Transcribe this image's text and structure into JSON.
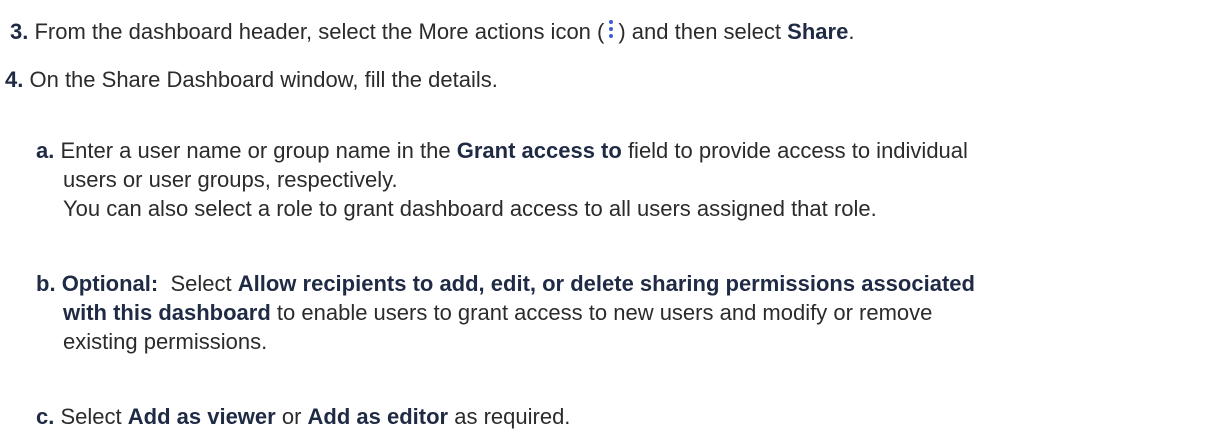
{
  "steps": [
    {
      "number": "3.",
      "text_before": "From the dashboard header, select the More actions icon (",
      "icon": "more-actions-kebab-icon",
      "text_after": ") and then select",
      "bold": "Share",
      "end": "."
    },
    {
      "number": "4.",
      "text": "On the Share Dashboard window, fill the details."
    }
  ],
  "substeps": {
    "a": {
      "label": "a.",
      "line1_before": "Enter a user name or group name in the",
      "line1_bold": "Grant access to",
      "line1_after": "field to provide access to individual",
      "line2": "users or user groups, respectively.",
      "line3": "You can also select a role to grant dashboard access to all users assigned that role."
    },
    "b": {
      "label": "b.",
      "optional": "Optional:",
      "select": "Select",
      "bold1": "Allow recipients to add, edit, or delete sharing permissions associated",
      "bold2": "with this dashboard",
      "line2_after": "to enable users to grant access to new users and modify or remove",
      "line3": "existing permissions."
    },
    "c": {
      "label": "c.",
      "before": "Select",
      "bold1": "Add as viewer",
      "middle": "or",
      "bold2": "Add as editor",
      "after": "as required."
    }
  },
  "colors": {
    "text": "#2b2b2b",
    "bold": "#1f2a44",
    "icon": "#3b5bdb"
  }
}
